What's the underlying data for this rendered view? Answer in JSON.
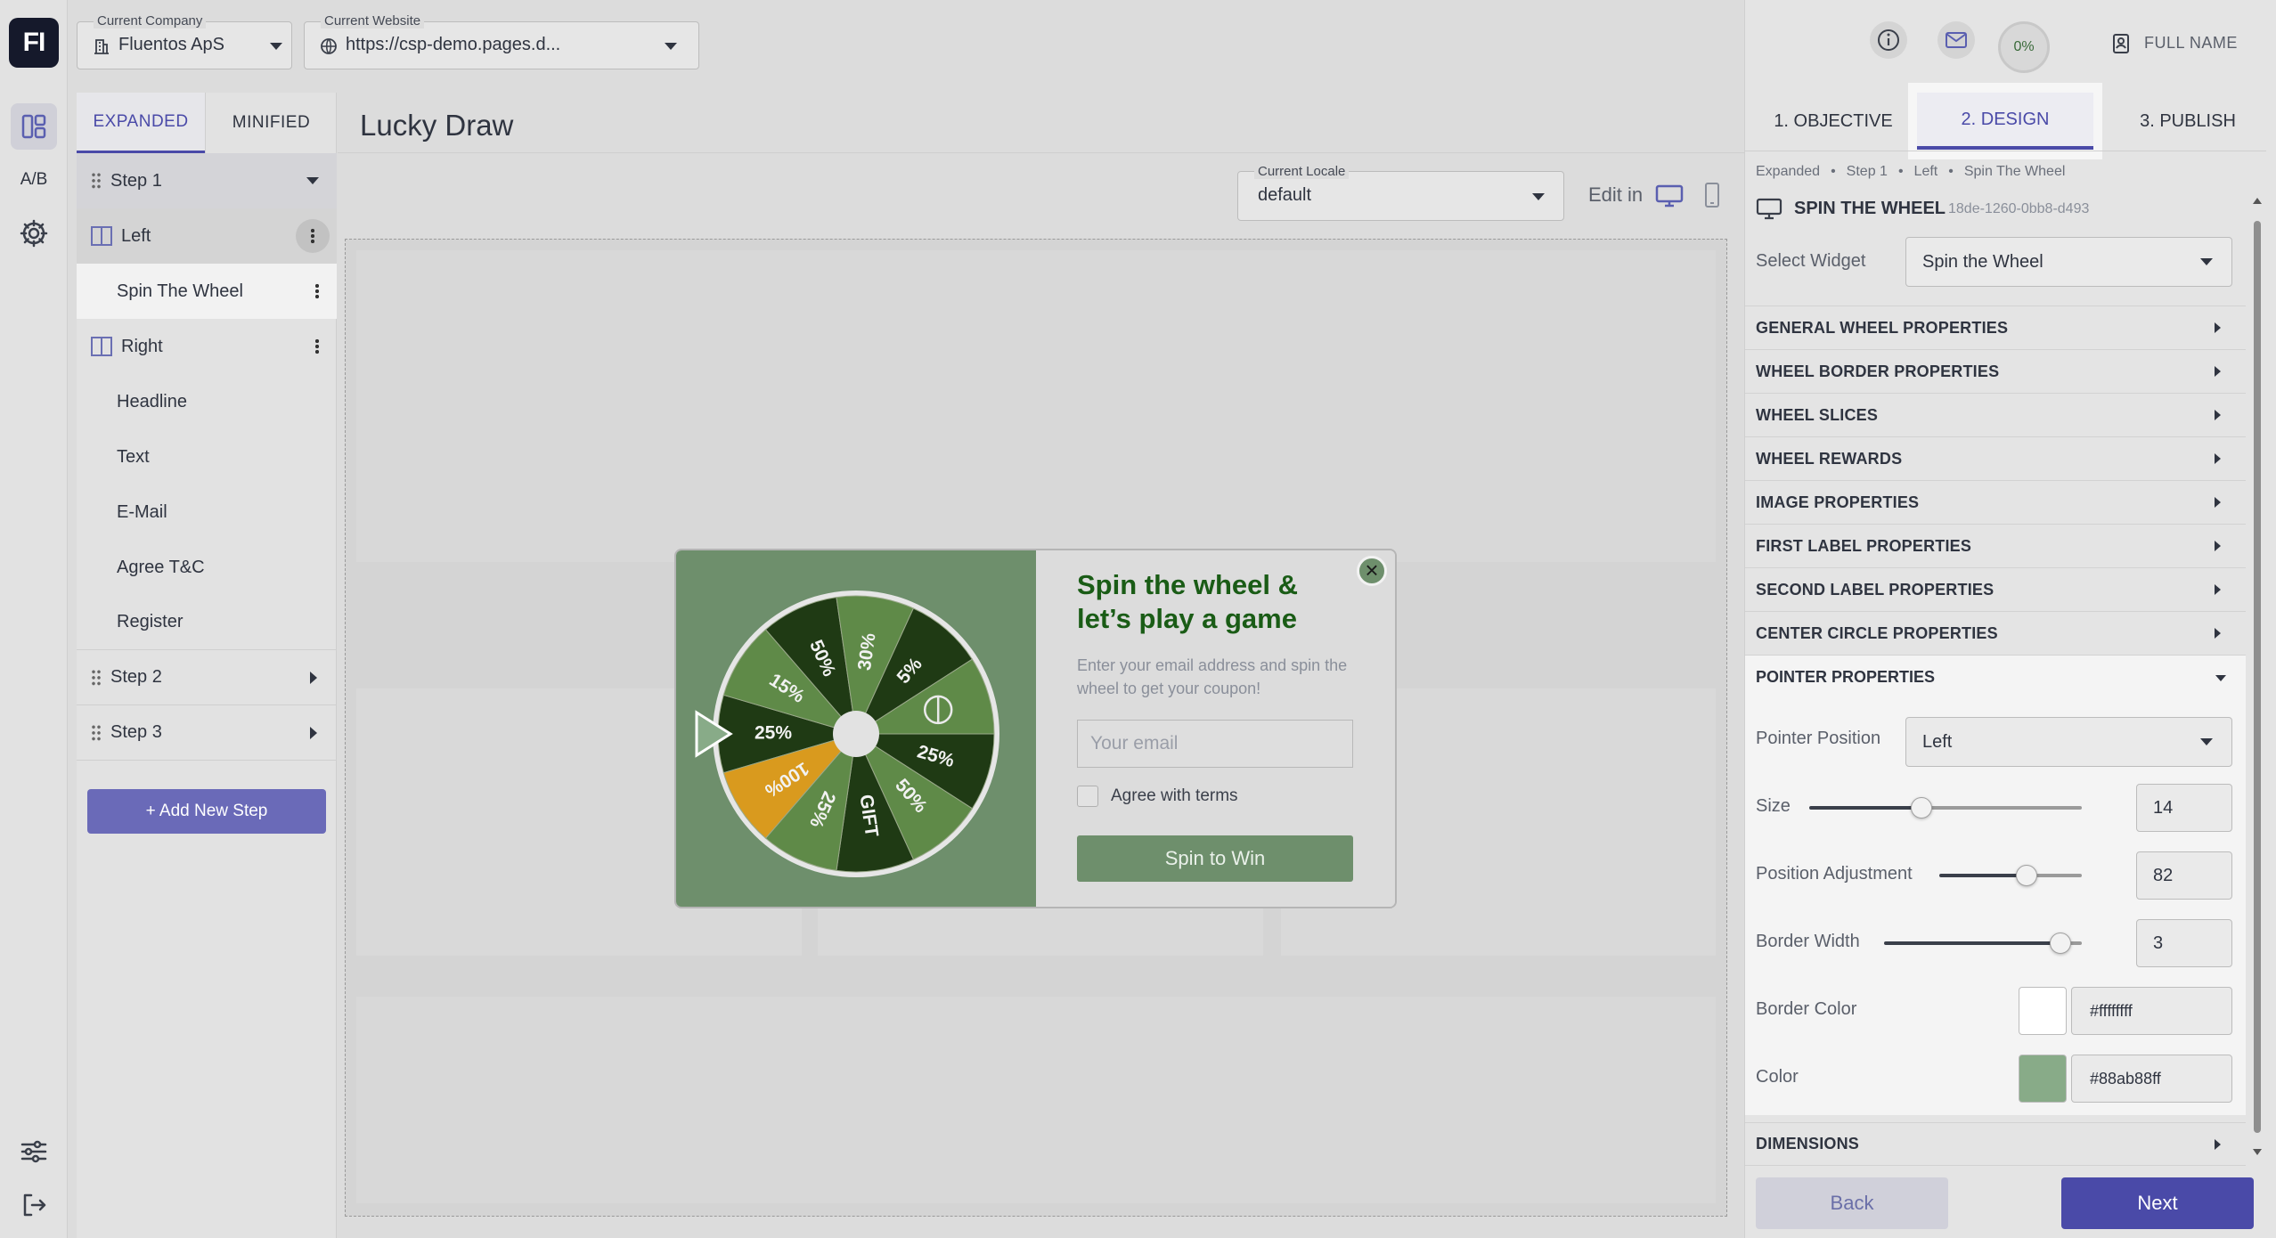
{
  "app": {
    "logo_text": "FI",
    "rail": {
      "ab_label": "A/B"
    }
  },
  "topbar": {
    "company": {
      "label": "Current Company",
      "value": "Fluentos ApS"
    },
    "website": {
      "label": "Current Website",
      "value": "https://csp-demo.pages.d..."
    },
    "progress": "0%",
    "user_name": "FULL NAME"
  },
  "tree": {
    "tabs": [
      "EXPANDED",
      "MINIFIED"
    ],
    "step1": "Step 1",
    "left": "Left",
    "spin": "Spin The Wheel",
    "right": "Right",
    "right_items": [
      "Headline",
      "Text",
      "E-Mail",
      "Agree T&C",
      "Register"
    ],
    "step2": "Step 2",
    "step3": "Step 3",
    "add_step": "+ Add New Step"
  },
  "editor": {
    "title": "Lucky Draw",
    "locale_label": "Current Locale",
    "locale_value": "default",
    "edit_in": "Edit in"
  },
  "popup": {
    "headline": "Spin the wheel & let’s play a game",
    "text": "Enter your email address and spin the wheel to get your coupon!",
    "email_placeholder": "Your email",
    "agree": "Agree with terms",
    "cta": "Spin to Win",
    "close_symbol": "×",
    "slices": [
      "25%",
      "15%",
      "50%",
      "30%",
      "5%",
      "",
      "25%",
      "50%",
      "GIFT",
      "25%",
      "100%"
    ],
    "colors": {
      "bg": "#6e8f6c",
      "slice_dark": "#1f3a14",
      "slice_mid": "#5f8a48",
      "slice_light": "#88ab88",
      "slice_gold": "#d99a1e",
      "headline": "#1a5c16",
      "cta": "#6e8f6c"
    }
  },
  "rpanel": {
    "tabs": [
      "1. OBJECTIVE",
      "2. DESIGN",
      "3. PUBLISH"
    ],
    "breadcrumb": [
      "Expanded",
      "Step 1",
      "Left",
      "Spin The Wheel"
    ],
    "widget_title": "SPIN THE WHEEL",
    "widget_id": "18de-1260-0bb8-d493",
    "select_widget_label": "Select Widget",
    "select_widget_value": "Spin the Wheel",
    "sections": [
      "GENERAL WHEEL PROPERTIES",
      "WHEEL BORDER PROPERTIES",
      "WHEEL SLICES",
      "WHEEL REWARDS",
      "IMAGE PROPERTIES",
      "FIRST LABEL PROPERTIES",
      "SECOND LABEL PROPERTIES",
      "CENTER CIRCLE PROPERTIES"
    ],
    "pointer": {
      "title": "POINTER PROPERTIES",
      "position_label": "Pointer Position",
      "position_value": "Left",
      "size_label": "Size",
      "size_value": "14",
      "posadj_label": "Position Adjustment",
      "posadj_value": "82",
      "bw_label": "Border Width",
      "bw_value": "3",
      "bc_label": "Border Color",
      "bc_value": "#ffffffff",
      "color_label": "Color",
      "color_value": "#88ab88ff",
      "swatch_border": "#ffffff",
      "swatch_color": "#88ab88"
    },
    "dimensions": "DIMENSIONS",
    "back": "Back",
    "next": "Next",
    "accent": "#4a4aa8"
  }
}
